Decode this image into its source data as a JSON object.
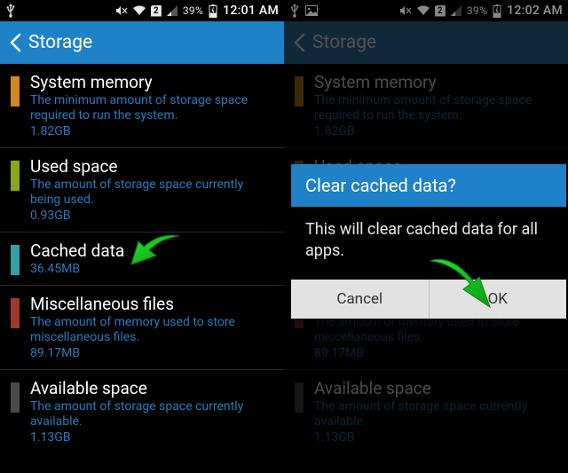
{
  "screenshots": {
    "left": {
      "status": {
        "battery_pct": "39%",
        "time": "12:01 AM"
      },
      "actionbar_title": "Storage"
    },
    "right": {
      "status": {
        "battery_pct": "39%",
        "time": "12:02 AM"
      },
      "actionbar_title": "Storage"
    }
  },
  "storage_rows": {
    "system": {
      "title": "System memory",
      "desc": "The minimum amount of storage space required to run the system.",
      "size": "1.82GB"
    },
    "used": {
      "title": "Used space",
      "desc": "The amount of storage space currently being used.",
      "size": "0.93GB"
    },
    "cached": {
      "title": "Cached data",
      "desc": "",
      "size": "36.45MB"
    },
    "misc": {
      "title": "Miscellaneous files",
      "desc": "The amount of memory used to store miscellaneous files.",
      "size": "89.17MB"
    },
    "available": {
      "title": "Available space",
      "desc": "The amount of storage space currently available.",
      "size": "1.13GB"
    }
  },
  "dialog": {
    "title": "Clear cached data?",
    "body": "This will clear cached data for all apps.",
    "cancel": "Cancel",
    "ok": "OK"
  },
  "status_icons": {
    "sim_slot": "2"
  }
}
